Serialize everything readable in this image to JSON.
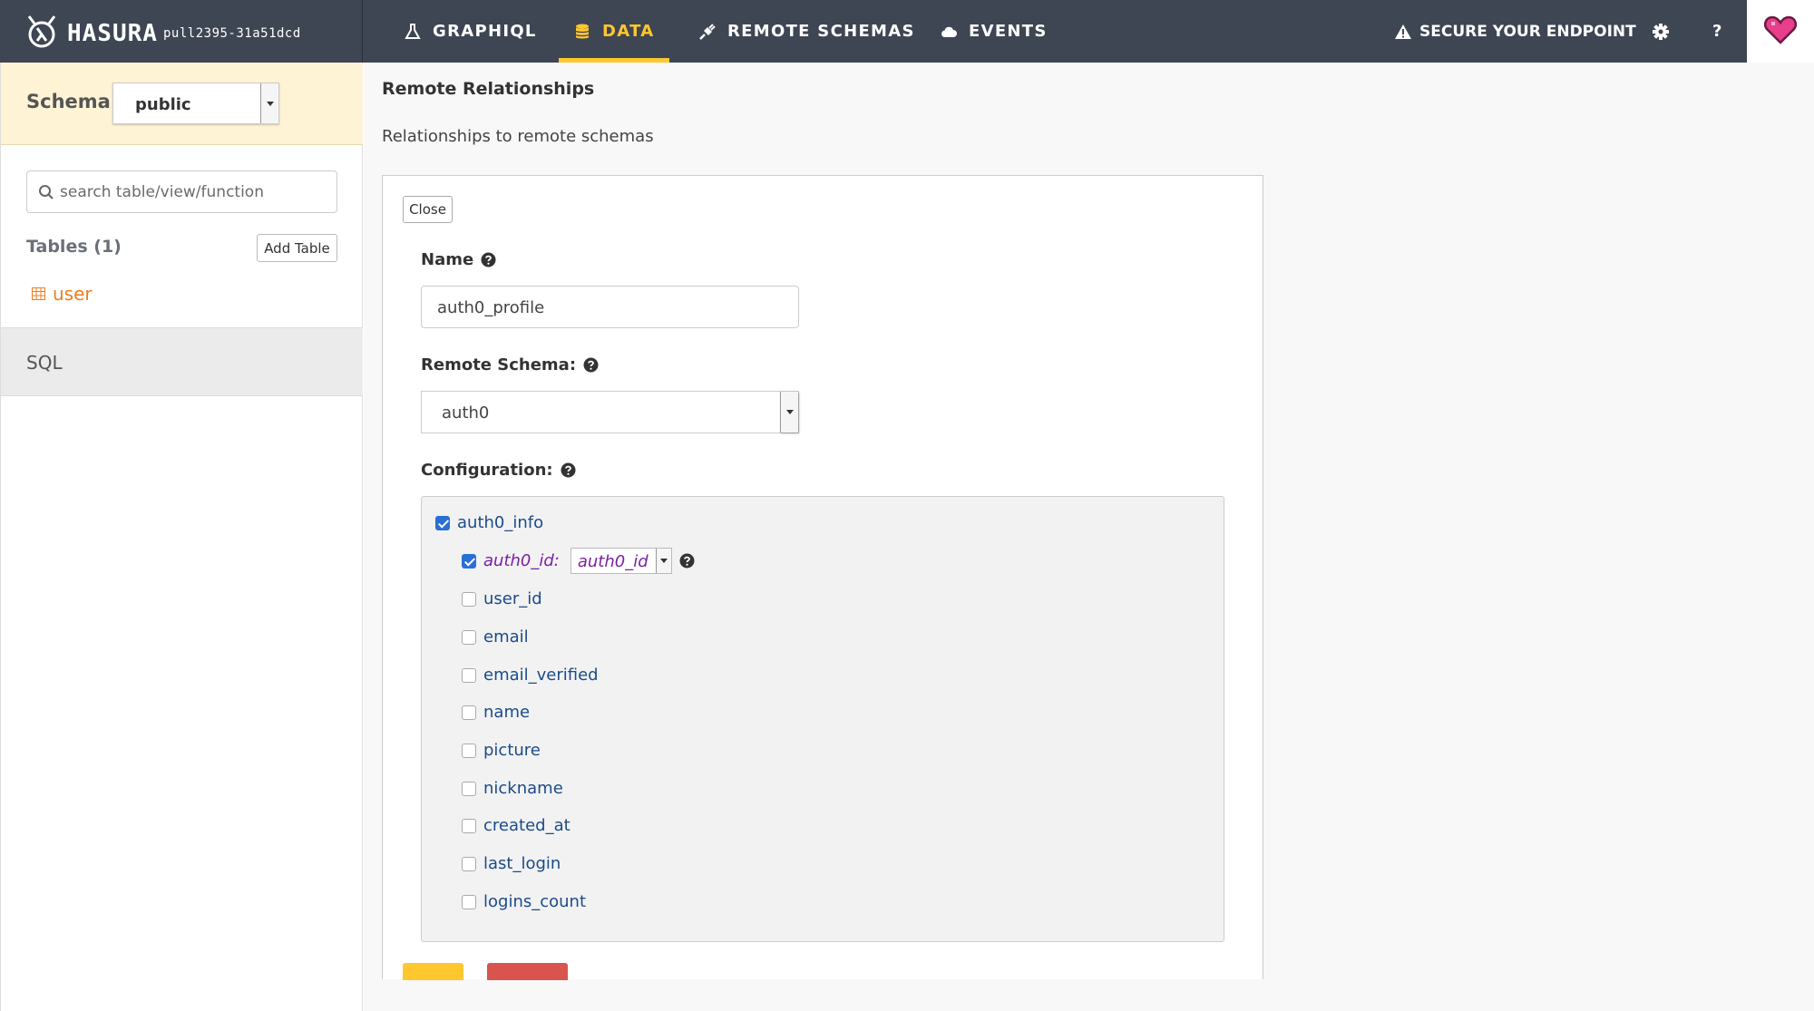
{
  "brand": {
    "name": "HASURA",
    "version": "pull2395-31a51dcd"
  },
  "nav": {
    "items": [
      {
        "label": "GRAPHIQL",
        "icon": "flask-icon"
      },
      {
        "label": "DATA",
        "icon": "database-icon",
        "active": true
      },
      {
        "label": "REMOTE SCHEMAS",
        "icon": "plug-icon"
      },
      {
        "label": "EVENTS",
        "icon": "cloud-icon"
      }
    ],
    "secure_label": "SECURE YOUR ENDPOINT",
    "help_label": "?"
  },
  "colors": {
    "topbar": "#3e4553",
    "accent": "#fdc82f",
    "table_link": "#f07d20",
    "field_name": "#1b4b8a",
    "arg": "#7a1fa2"
  },
  "sidebar": {
    "schema_label": "Schema:",
    "schema_value": "public",
    "search_placeholder": "search table/view/function",
    "tables_heading": "Tables (1)",
    "add_table_label": "Add Table",
    "tables": [
      "user"
    ],
    "sql_label": "SQL"
  },
  "main": {
    "title": "Remote Relationships",
    "subtitle": "Relationships to remote schemas",
    "close_label": "Close",
    "name_label": "Name",
    "name_value": "auth0_profile",
    "remote_schema_label": "Remote Schema:",
    "remote_schema_value": "auth0",
    "configuration_label": "Configuration:",
    "config": {
      "root_field": "auth0_info",
      "argument": {
        "name": "auth0_id:",
        "value": "auth0_id"
      },
      "fields": [
        "user_id",
        "email",
        "email_verified",
        "name",
        "picture",
        "nickname",
        "created_at",
        "last_login",
        "logins_count"
      ]
    }
  }
}
